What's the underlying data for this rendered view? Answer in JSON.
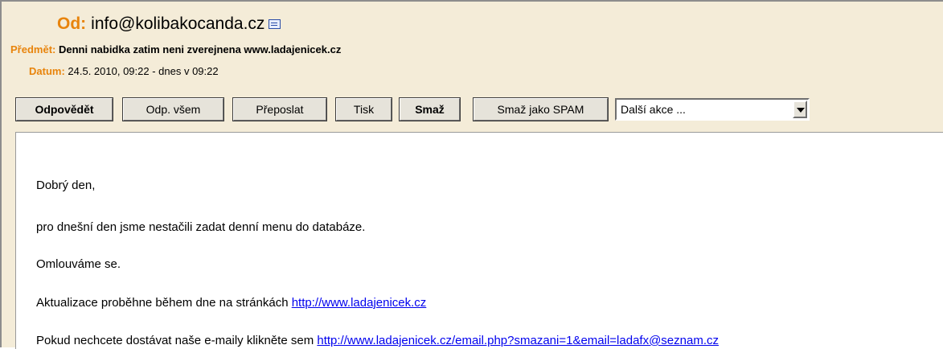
{
  "header": {
    "from_label": "Od:",
    "from_address": "info@kolibakocanda.cz",
    "subject_label": "Předmět:",
    "subject": "Denni nabidka zatim neni zverejnena www.ladajenicek.cz",
    "date_label": "Datum:",
    "date": "24.5. 2010, 09:22 - dnes v 09:22"
  },
  "toolbar": {
    "reply": "Odpovědět",
    "reply_all": "Odp. všem",
    "forward": "Přeposlat",
    "print": "Tisk",
    "delete": "Smaž",
    "delete_spam": "Smaž jako SPAM",
    "more_actions": "Další akce ..."
  },
  "icons": {
    "vcard": "vcard-icon",
    "dropdown": "chevron-down-icon"
  },
  "colors": {
    "label_orange": "#e8840c",
    "header_bg": "#f4ecd8",
    "link": "#0000ee"
  },
  "body": {
    "greeting": "Dobrý den,",
    "line1": "pro dnešní den jsme nestačili zadat denní menu do databáze.",
    "line2": "Omlouváme se.",
    "line3_text": "Aktualizace proběhne během dne na stránkách ",
    "line3_link": "http://www.ladajenicek.cz",
    "line4_text": "Pokud nechcete dostávat naše e-maily klikněte sem ",
    "line4_link": "http://www.ladajenicek.cz/email.php?smazani=1&email=ladafx@seznam.cz"
  }
}
